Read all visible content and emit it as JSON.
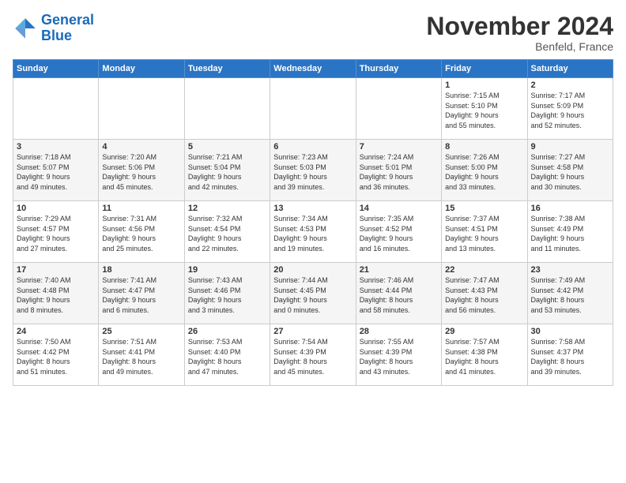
{
  "logo": {
    "line1": "General",
    "line2": "Blue"
  },
  "title": "November 2024",
  "location": "Benfeld, France",
  "days_of_week": [
    "Sunday",
    "Monday",
    "Tuesday",
    "Wednesday",
    "Thursday",
    "Friday",
    "Saturday"
  ],
  "weeks": [
    [
      {
        "day": "",
        "info": ""
      },
      {
        "day": "",
        "info": ""
      },
      {
        "day": "",
        "info": ""
      },
      {
        "day": "",
        "info": ""
      },
      {
        "day": "",
        "info": ""
      },
      {
        "day": "1",
        "info": "Sunrise: 7:15 AM\nSunset: 5:10 PM\nDaylight: 9 hours\nand 55 minutes."
      },
      {
        "day": "2",
        "info": "Sunrise: 7:17 AM\nSunset: 5:09 PM\nDaylight: 9 hours\nand 52 minutes."
      }
    ],
    [
      {
        "day": "3",
        "info": "Sunrise: 7:18 AM\nSunset: 5:07 PM\nDaylight: 9 hours\nand 49 minutes."
      },
      {
        "day": "4",
        "info": "Sunrise: 7:20 AM\nSunset: 5:06 PM\nDaylight: 9 hours\nand 45 minutes."
      },
      {
        "day": "5",
        "info": "Sunrise: 7:21 AM\nSunset: 5:04 PM\nDaylight: 9 hours\nand 42 minutes."
      },
      {
        "day": "6",
        "info": "Sunrise: 7:23 AM\nSunset: 5:03 PM\nDaylight: 9 hours\nand 39 minutes."
      },
      {
        "day": "7",
        "info": "Sunrise: 7:24 AM\nSunset: 5:01 PM\nDaylight: 9 hours\nand 36 minutes."
      },
      {
        "day": "8",
        "info": "Sunrise: 7:26 AM\nSunset: 5:00 PM\nDaylight: 9 hours\nand 33 minutes."
      },
      {
        "day": "9",
        "info": "Sunrise: 7:27 AM\nSunset: 4:58 PM\nDaylight: 9 hours\nand 30 minutes."
      }
    ],
    [
      {
        "day": "10",
        "info": "Sunrise: 7:29 AM\nSunset: 4:57 PM\nDaylight: 9 hours\nand 27 minutes."
      },
      {
        "day": "11",
        "info": "Sunrise: 7:31 AM\nSunset: 4:56 PM\nDaylight: 9 hours\nand 25 minutes."
      },
      {
        "day": "12",
        "info": "Sunrise: 7:32 AM\nSunset: 4:54 PM\nDaylight: 9 hours\nand 22 minutes."
      },
      {
        "day": "13",
        "info": "Sunrise: 7:34 AM\nSunset: 4:53 PM\nDaylight: 9 hours\nand 19 minutes."
      },
      {
        "day": "14",
        "info": "Sunrise: 7:35 AM\nSunset: 4:52 PM\nDaylight: 9 hours\nand 16 minutes."
      },
      {
        "day": "15",
        "info": "Sunrise: 7:37 AM\nSunset: 4:51 PM\nDaylight: 9 hours\nand 13 minutes."
      },
      {
        "day": "16",
        "info": "Sunrise: 7:38 AM\nSunset: 4:49 PM\nDaylight: 9 hours\nand 11 minutes."
      }
    ],
    [
      {
        "day": "17",
        "info": "Sunrise: 7:40 AM\nSunset: 4:48 PM\nDaylight: 9 hours\nand 8 minutes."
      },
      {
        "day": "18",
        "info": "Sunrise: 7:41 AM\nSunset: 4:47 PM\nDaylight: 9 hours\nand 6 minutes."
      },
      {
        "day": "19",
        "info": "Sunrise: 7:43 AM\nSunset: 4:46 PM\nDaylight: 9 hours\nand 3 minutes."
      },
      {
        "day": "20",
        "info": "Sunrise: 7:44 AM\nSunset: 4:45 PM\nDaylight: 9 hours\nand 0 minutes."
      },
      {
        "day": "21",
        "info": "Sunrise: 7:46 AM\nSunset: 4:44 PM\nDaylight: 8 hours\nand 58 minutes."
      },
      {
        "day": "22",
        "info": "Sunrise: 7:47 AM\nSunset: 4:43 PM\nDaylight: 8 hours\nand 56 minutes."
      },
      {
        "day": "23",
        "info": "Sunrise: 7:49 AM\nSunset: 4:42 PM\nDaylight: 8 hours\nand 53 minutes."
      }
    ],
    [
      {
        "day": "24",
        "info": "Sunrise: 7:50 AM\nSunset: 4:42 PM\nDaylight: 8 hours\nand 51 minutes."
      },
      {
        "day": "25",
        "info": "Sunrise: 7:51 AM\nSunset: 4:41 PM\nDaylight: 8 hours\nand 49 minutes."
      },
      {
        "day": "26",
        "info": "Sunrise: 7:53 AM\nSunset: 4:40 PM\nDaylight: 8 hours\nand 47 minutes."
      },
      {
        "day": "27",
        "info": "Sunrise: 7:54 AM\nSunset: 4:39 PM\nDaylight: 8 hours\nand 45 minutes."
      },
      {
        "day": "28",
        "info": "Sunrise: 7:55 AM\nSunset: 4:39 PM\nDaylight: 8 hours\nand 43 minutes."
      },
      {
        "day": "29",
        "info": "Sunrise: 7:57 AM\nSunset: 4:38 PM\nDaylight: 8 hours\nand 41 minutes."
      },
      {
        "day": "30",
        "info": "Sunrise: 7:58 AM\nSunset: 4:37 PM\nDaylight: 8 hours\nand 39 minutes."
      }
    ]
  ]
}
